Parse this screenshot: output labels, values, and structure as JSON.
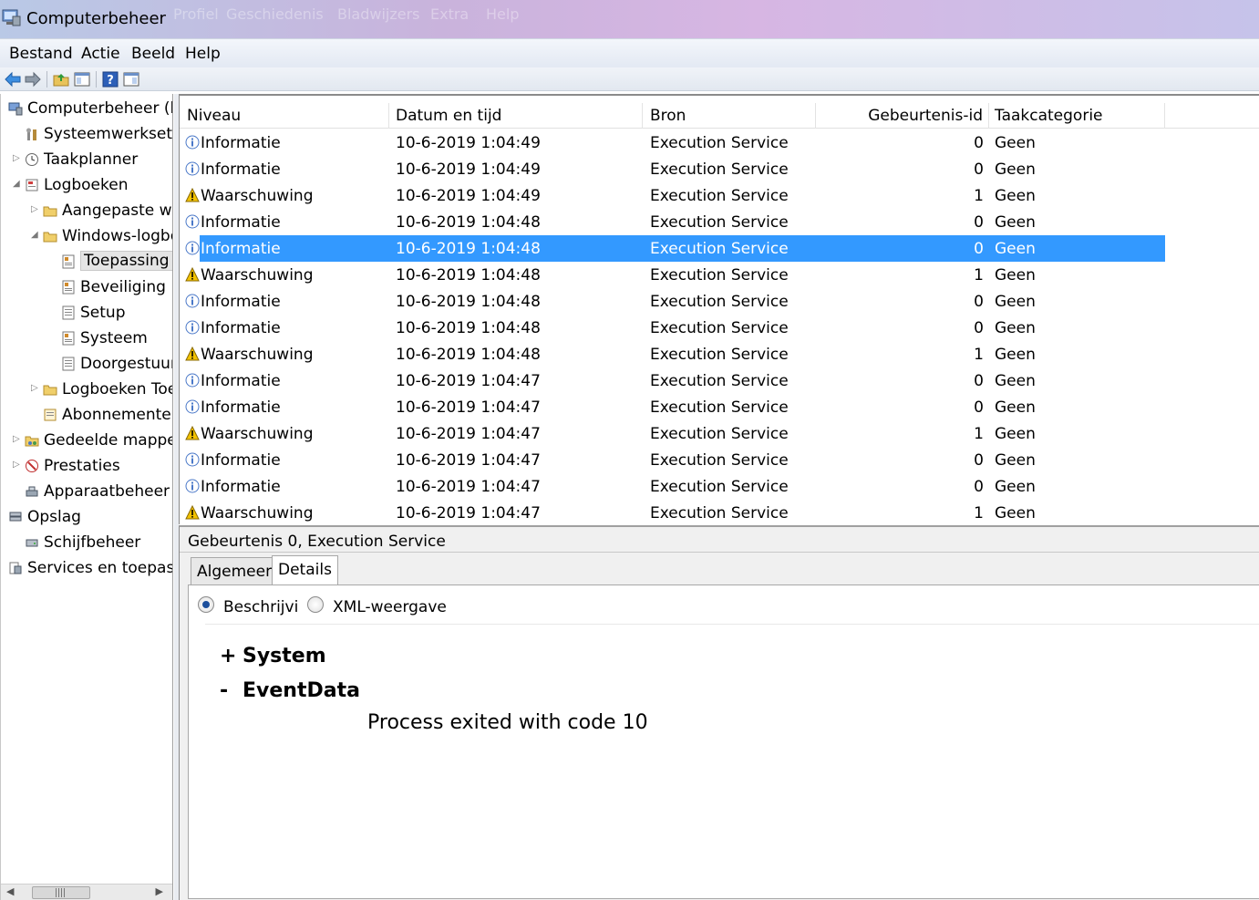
{
  "window": {
    "title": "Computerbeheer",
    "ghost_menu": [
      "Profiel",
      "Geschiedenis",
      "Bladwijzers",
      "Extra",
      "Help"
    ]
  },
  "menu": [
    "Bestand",
    "Actie",
    "Beeld",
    "Help"
  ],
  "tree": {
    "items": [
      {
        "label": "Computerbeheer (loka",
        "icon": "computer-management-icon",
        "expander": ""
      },
      {
        "label": "Systeemwerkset",
        "icon": "system-tools-icon",
        "expander": ""
      },
      {
        "label": "Taakplanner",
        "icon": "clock-icon",
        "expander": "collapsed"
      },
      {
        "label": "Logboeken",
        "icon": "event-viewer-icon",
        "expander": "expanded"
      },
      {
        "label": "Aangepaste we",
        "icon": "folder-icon",
        "expander": "collapsed"
      },
      {
        "label": "Windows-logbo",
        "icon": "folder-icon",
        "expander": "expanded"
      },
      {
        "label": "Toepassing",
        "icon": "log-icon",
        "expander": ""
      },
      {
        "label": "Beveiliging",
        "icon": "log-icon",
        "expander": ""
      },
      {
        "label": "Setup",
        "icon": "log-plain-icon",
        "expander": ""
      },
      {
        "label": "Systeem",
        "icon": "log-icon",
        "expander": ""
      },
      {
        "label": "Doorgestuur",
        "icon": "log-plain-icon",
        "expander": ""
      },
      {
        "label": "Logboeken Toe",
        "icon": "folder-icon",
        "expander": "collapsed"
      },
      {
        "label": "Abonnementer",
        "icon": "subscriptions-icon",
        "expander": ""
      },
      {
        "label": "Gedeelde mapper",
        "icon": "shared-folder-icon",
        "expander": "collapsed"
      },
      {
        "label": "Prestaties",
        "icon": "performance-icon",
        "expander": "collapsed"
      },
      {
        "label": "Apparaatbeheer",
        "icon": "device-manager-icon",
        "expander": ""
      },
      {
        "label": "Opslag",
        "icon": "storage-icon",
        "expander": ""
      },
      {
        "label": "Schijfbeheer",
        "icon": "disk-icon",
        "expander": ""
      },
      {
        "label": "Services en toepassi",
        "icon": "services-icon",
        "expander": ""
      }
    ]
  },
  "list": {
    "columns": [
      "Niveau",
      "Datum en tijd",
      "Bron",
      "Gebeurtenis-id",
      "Taakcategorie"
    ],
    "rows": [
      {
        "level": "Informatie",
        "type": "info",
        "datetime": "10-6-2019 1:04:49",
        "source": "Execution Service",
        "id": "0",
        "category": "Geen"
      },
      {
        "level": "Informatie",
        "type": "info",
        "datetime": "10-6-2019 1:04:49",
        "source": "Execution Service",
        "id": "0",
        "category": "Geen"
      },
      {
        "level": "Waarschuwing",
        "type": "warn",
        "datetime": "10-6-2019 1:04:49",
        "source": "Execution Service",
        "id": "1",
        "category": "Geen"
      },
      {
        "level": "Informatie",
        "type": "info",
        "datetime": "10-6-2019 1:04:48",
        "source": "Execution Service",
        "id": "0",
        "category": "Geen"
      },
      {
        "level": "Informatie",
        "type": "info",
        "datetime": "10-6-2019 1:04:48",
        "source": "Execution Service",
        "id": "0",
        "category": "Geen",
        "selected": true
      },
      {
        "level": "Waarschuwing",
        "type": "warn",
        "datetime": "10-6-2019 1:04:48",
        "source": "Execution Service",
        "id": "1",
        "category": "Geen"
      },
      {
        "level": "Informatie",
        "type": "info",
        "datetime": "10-6-2019 1:04:48",
        "source": "Execution Service",
        "id": "0",
        "category": "Geen"
      },
      {
        "level": "Informatie",
        "type": "info",
        "datetime": "10-6-2019 1:04:48",
        "source": "Execution Service",
        "id": "0",
        "category": "Geen"
      },
      {
        "level": "Waarschuwing",
        "type": "warn",
        "datetime": "10-6-2019 1:04:48",
        "source": "Execution Service",
        "id": "1",
        "category": "Geen"
      },
      {
        "level": "Informatie",
        "type": "info",
        "datetime": "10-6-2019 1:04:47",
        "source": "Execution Service",
        "id": "0",
        "category": "Geen"
      },
      {
        "level": "Informatie",
        "type": "info",
        "datetime": "10-6-2019 1:04:47",
        "source": "Execution Service",
        "id": "0",
        "category": "Geen"
      },
      {
        "level": "Waarschuwing",
        "type": "warn",
        "datetime": "10-6-2019 1:04:47",
        "source": "Execution Service",
        "id": "1",
        "category": "Geen"
      },
      {
        "level": "Informatie",
        "type": "info",
        "datetime": "10-6-2019 1:04:47",
        "source": "Execution Service",
        "id": "0",
        "category": "Geen"
      },
      {
        "level": "Informatie",
        "type": "info",
        "datetime": "10-6-2019 1:04:47",
        "source": "Execution Service",
        "id": "0",
        "category": "Geen"
      },
      {
        "level": "Waarschuwing",
        "type": "warn",
        "datetime": "10-6-2019 1:04:47",
        "source": "Execution Service",
        "id": "1",
        "category": "Geen"
      }
    ]
  },
  "details": {
    "caption": "Gebeurtenis 0, Execution Service",
    "tabs": [
      "Algemeen",
      "Details"
    ],
    "active_tab": "Details",
    "view_options": [
      "Beschrijvi",
      "XML-weergave"
    ],
    "selected_view": "Beschrijvi",
    "system_sign": "+",
    "system_label": "System",
    "eventdata_sign": "-",
    "eventdata_label": "EventData",
    "eventdata_value": "Process exited with code 10"
  },
  "colors": {
    "selection": "#3399ff",
    "warning": "#f2c200",
    "info": "#4a78c8"
  }
}
